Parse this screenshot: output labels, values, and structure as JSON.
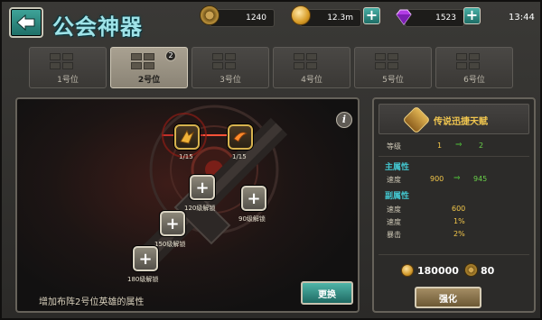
{
  "header": {
    "title": "公会神器",
    "time": "13:44",
    "resources": [
      {
        "name": "guild-token",
        "value": "1240",
        "icon": "cog-coin-icon"
      },
      {
        "name": "gold",
        "value": "12.3m",
        "icon": "gold-coin-icon"
      },
      {
        "name": "gem",
        "value": "1523",
        "icon": "purple-gem-icon"
      }
    ]
  },
  "tabs": [
    {
      "label": "1号位"
    },
    {
      "label": "2号位",
      "badge": "2",
      "active": true
    },
    {
      "label": "3号位"
    },
    {
      "label": "4号位"
    },
    {
      "label": "5号位"
    },
    {
      "label": "6号位"
    }
  ],
  "artifact": {
    "nodes": [
      {
        "label": "1/15",
        "type": "skill"
      },
      {
        "label": "1/15",
        "type": "skill"
      },
      {
        "label": "120级解锁",
        "type": "locked"
      },
      {
        "label": "90级解锁",
        "type": "locked"
      },
      {
        "label": "150级解锁",
        "type": "locked"
      },
      {
        "label": "180级解锁",
        "type": "locked"
      }
    ],
    "description": "增加布阵2号位英雄的属性",
    "change_button": "更换"
  },
  "detail": {
    "title": "传说迅捷天赋",
    "level_label": "等级",
    "level_from": "1",
    "level_to": "2",
    "main_attr_title": "主属性",
    "main_attr": {
      "name": "速度",
      "from": "900",
      "to": "945"
    },
    "sub_attr_title": "副属性",
    "sub_attrs": [
      {
        "name": "速度",
        "value": "600"
      },
      {
        "name": "速度",
        "value": "1%"
      },
      {
        "name": "暴击",
        "value": "2%"
      }
    ],
    "cost_gold": "180000",
    "cost_token": "80",
    "upgrade_button": "强化"
  },
  "colors": {
    "accent_teal": "#1e6d66",
    "title_cyan": "#9fe3e8",
    "yellow_value": "#f3c74a",
    "green_value": "#6ad24a"
  }
}
